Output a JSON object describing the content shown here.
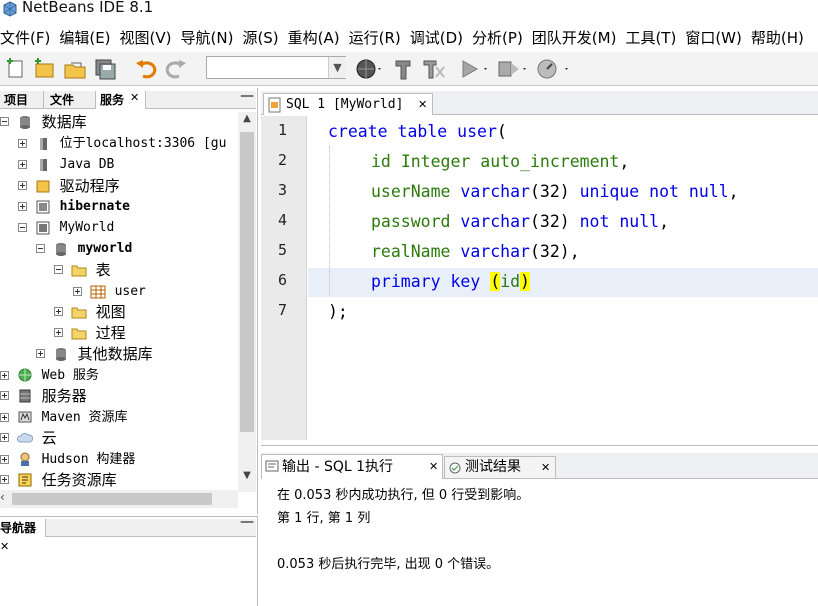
{
  "window": {
    "title": "NetBeans IDE 8.1"
  },
  "menubar": {
    "items": [
      "文件(F)",
      "编辑(E)",
      "视图(V)",
      "导航(N)",
      "源(S)",
      "重构(A)",
      "运行(R)",
      "调试(D)",
      "分析(P)",
      "团队开发(M)",
      "工具(T)",
      "窗口(W)",
      "帮助(H)"
    ]
  },
  "toolbar": {
    "config_value": ""
  },
  "left_panel": {
    "tabs": [
      "项目",
      "文件",
      "服务"
    ],
    "close": "✕",
    "minimize": "—",
    "tree": [
      {
        "label": "数据库"
      },
      {
        "label": "位于localhost:3306 [gu"
      },
      {
        "label": "Java DB"
      },
      {
        "label": "驱动程序"
      },
      {
        "label": "hibernate"
      },
      {
        "label": "MyWorld"
      },
      {
        "label": "myworld"
      },
      {
        "label": "表"
      },
      {
        "label": "user"
      },
      {
        "label": "视图"
      },
      {
        "label": "过程"
      },
      {
        "label": "其他数据库"
      },
      {
        "label": "Web 服务"
      },
      {
        "label": "服务器"
      },
      {
        "label": "Maven 资源库"
      },
      {
        "label": "云"
      },
      {
        "label": "Hudson 构建器"
      },
      {
        "label": "任务资源库"
      }
    ]
  },
  "navigator": {
    "tab": "导航器",
    "close": "✕",
    "minimize": "—"
  },
  "editor": {
    "tab_label": "SQL 1 [MyWorld]",
    "tab_close": "✕",
    "line_numbers": [
      "1",
      "2",
      "3",
      "4",
      "5",
      "6",
      "7"
    ],
    "code": {
      "l1_kw": "create table ",
      "l1_id": "user",
      "l1_tail": "(",
      "l2_a": "id ",
      "l2_b": "Integer ",
      "l2_c": "auto_increment",
      "l2_d": ",",
      "l3_a": "userName ",
      "l3_b": "varchar",
      "l3_c": "(32) ",
      "l3_d": "unique not null",
      "l3_e": ",",
      "l4_a": "password ",
      "l4_b": "varchar",
      "l4_c": "(32) ",
      "l4_d": "not null",
      "l4_e": ",",
      "l5_a": "realName ",
      "l5_b": "varchar",
      "l5_c": "(32),",
      "l6_a": "primary key ",
      "l6_b": "(",
      "l6_c": "id",
      "l6_d": ")",
      "l7": ");"
    }
  },
  "output": {
    "tab_output": "输出 - SQL 1执行",
    "tab_tests": "测试结果",
    "close": "✕",
    "lines": [
      "在 0.053 秒内成功执行, 但 0 行受到影响。",
      "第 1 行, 第 1 列",
      "",
      "0.053 秒后执行完毕, 出现 0 个错误。"
    ]
  }
}
